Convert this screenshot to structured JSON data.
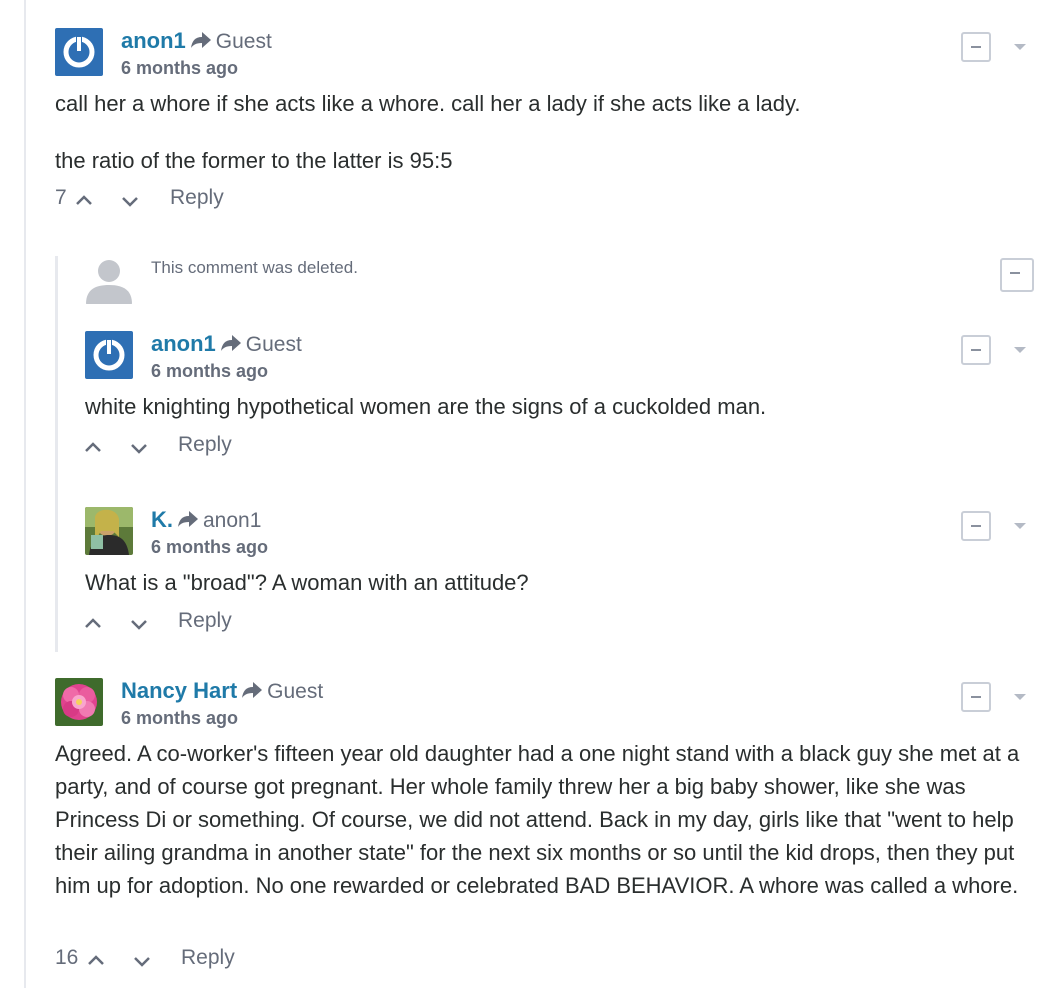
{
  "colors": {
    "author": "#1f7aa8",
    "muted": "#656c7a",
    "text": "#2a2e2e",
    "disqus_blue": "#2e6fb4"
  },
  "comments": [
    {
      "author": "anon1",
      "reply_to": "Guest",
      "time": "6 months ago",
      "paragraphs": [
        "call her a whore if she acts like a whore. call her a lady if she acts like a lady.",
        "the ratio of the former to the latter is 95:5"
      ],
      "votes": "7",
      "reply_label": "Reply",
      "avatar_icon": "disqus-power-icon"
    },
    {
      "deleted_text": "This comment was deleted.",
      "avatar_icon": "default-user-icon"
    },
    {
      "author": "anon1",
      "reply_to": "Guest",
      "time": "6 months ago",
      "paragraphs": [
        "white knighting hypothetical women are the signs of a cuckolded man."
      ],
      "votes": "",
      "reply_label": "Reply",
      "avatar_icon": "disqus-power-icon"
    },
    {
      "author": "K.",
      "reply_to": "anon1",
      "time": "6 months ago",
      "paragraphs": [
        "What is a \"broad\"? A woman with an attitude?"
      ],
      "votes": "",
      "reply_label": "Reply",
      "avatar_icon": "user-photo-icon"
    },
    {
      "author": "Nancy Hart",
      "reply_to": "Guest",
      "time": "6 months ago",
      "paragraphs": [
        "Agreed. A co-worker's fifteen year old daughter had a one night stand with a black guy she met at a party, and of course got pregnant. Her whole family threw her a big baby shower, like she was Princess Di or something. Of course, we did not attend. Back in my day, girls like that \"went to help their ailing grandma in another state\" for the next six months or so until the kid drops, then they put him up for adoption. No one rewarded or celebrated BAD BEHAVIOR. A whore was called a whore."
      ],
      "votes": "16",
      "reply_label": "Reply",
      "avatar_icon": "flower-photo-icon"
    }
  ]
}
